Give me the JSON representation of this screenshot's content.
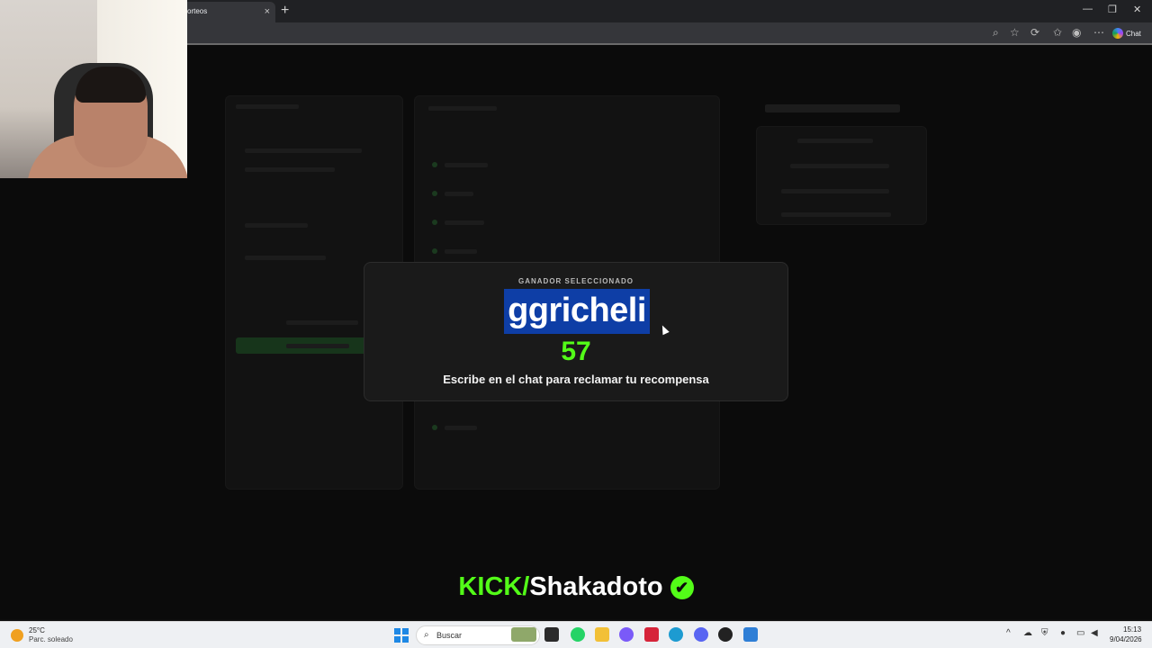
{
  "browser": {
    "tab_title": "orteos",
    "tab_close": "×",
    "new_tab": "+",
    "chat_label": "Chat",
    "window_minimize": "—",
    "window_restore": "❐",
    "window_close": "✕"
  },
  "modal": {
    "label": "GANADOR SELECCIONADO",
    "winner_name": "ggricheli",
    "winner_number": "57",
    "claim_text": "Escribe en el chat para reclamar tu recompensa"
  },
  "watermark": {
    "kick": "KICK/",
    "channel": "Shakadoto",
    "verified_icon": "✔"
  },
  "taskbar": {
    "weather_temp": "25°C",
    "weather_desc": "Parc. soleado",
    "search_placeholder": "Buscar",
    "clock_time": "15:13",
    "clock_date": "9/04/2026"
  },
  "colors": {
    "kick_green": "#53fc18",
    "winner_highlight": "#0e3ea6",
    "modal_bg": "#1a1a1a"
  }
}
